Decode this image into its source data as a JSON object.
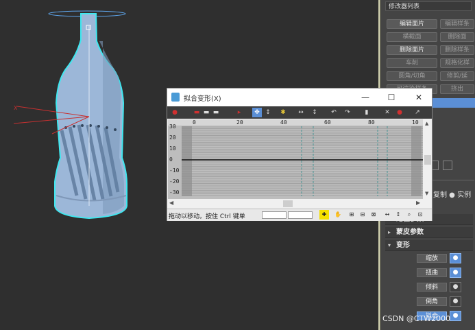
{
  "viewport": {
    "axis_label": "X",
    "colors": {
      "background": "#2f2f2f",
      "bottle": "#9cb7d8",
      "selection": "#3ee8f0",
      "axis": "#c83030"
    }
  },
  "modifier_panel": {
    "title": "修改器列表",
    "buttons": [
      {
        "label": "编辑面片",
        "dim": false
      },
      {
        "label": "编辑样条",
        "dim": true
      },
      {
        "label": "横截面",
        "dim": true
      },
      {
        "label": "删除面",
        "dim": true
      },
      {
        "label": "删除面片",
        "dim": false
      },
      {
        "label": "删除样条",
        "dim": true
      },
      {
        "label": "车削",
        "dim": true
      },
      {
        "label": "规格化样",
        "dim": true
      },
      {
        "label": "圆角/切角",
        "dim": true
      },
      {
        "label": "修剪/延",
        "dim": true
      },
      {
        "label": "可渲染样条",
        "dim": true
      },
      {
        "label": "挤出",
        "dim": true
      }
    ],
    "rollouts": [
      {
        "label": "路径参数",
        "expanded": false
      },
      {
        "label": "蒙皮参数",
        "expanded": false
      },
      {
        "label": "变形",
        "expanded": true
      }
    ],
    "deformations": [
      {
        "label": "缩放",
        "active": true
      },
      {
        "label": "扭曲",
        "active": true
      },
      {
        "label": "倾斜",
        "active": false
      },
      {
        "label": "倒角",
        "active": false
      },
      {
        "label": "拟合",
        "active": true
      }
    ],
    "copy_options": "复制 ● 实例"
  },
  "fit_dialog": {
    "title": "拟合变形(X)",
    "window_controls": {
      "minimize": "—",
      "maximize": "☐",
      "close": "✕"
    },
    "y_ticks": [
      "30",
      "20",
      "10",
      "0",
      "-10",
      "-20",
      "-30"
    ],
    "x_ticks": [
      "0",
      "20",
      "40",
      "60",
      "80",
      "10"
    ],
    "status_text": "拖动以移动。按住 Ctrl 键单",
    "accent_color": "#5b8fd6"
  },
  "watermark": "CSDN @CTW2000"
}
